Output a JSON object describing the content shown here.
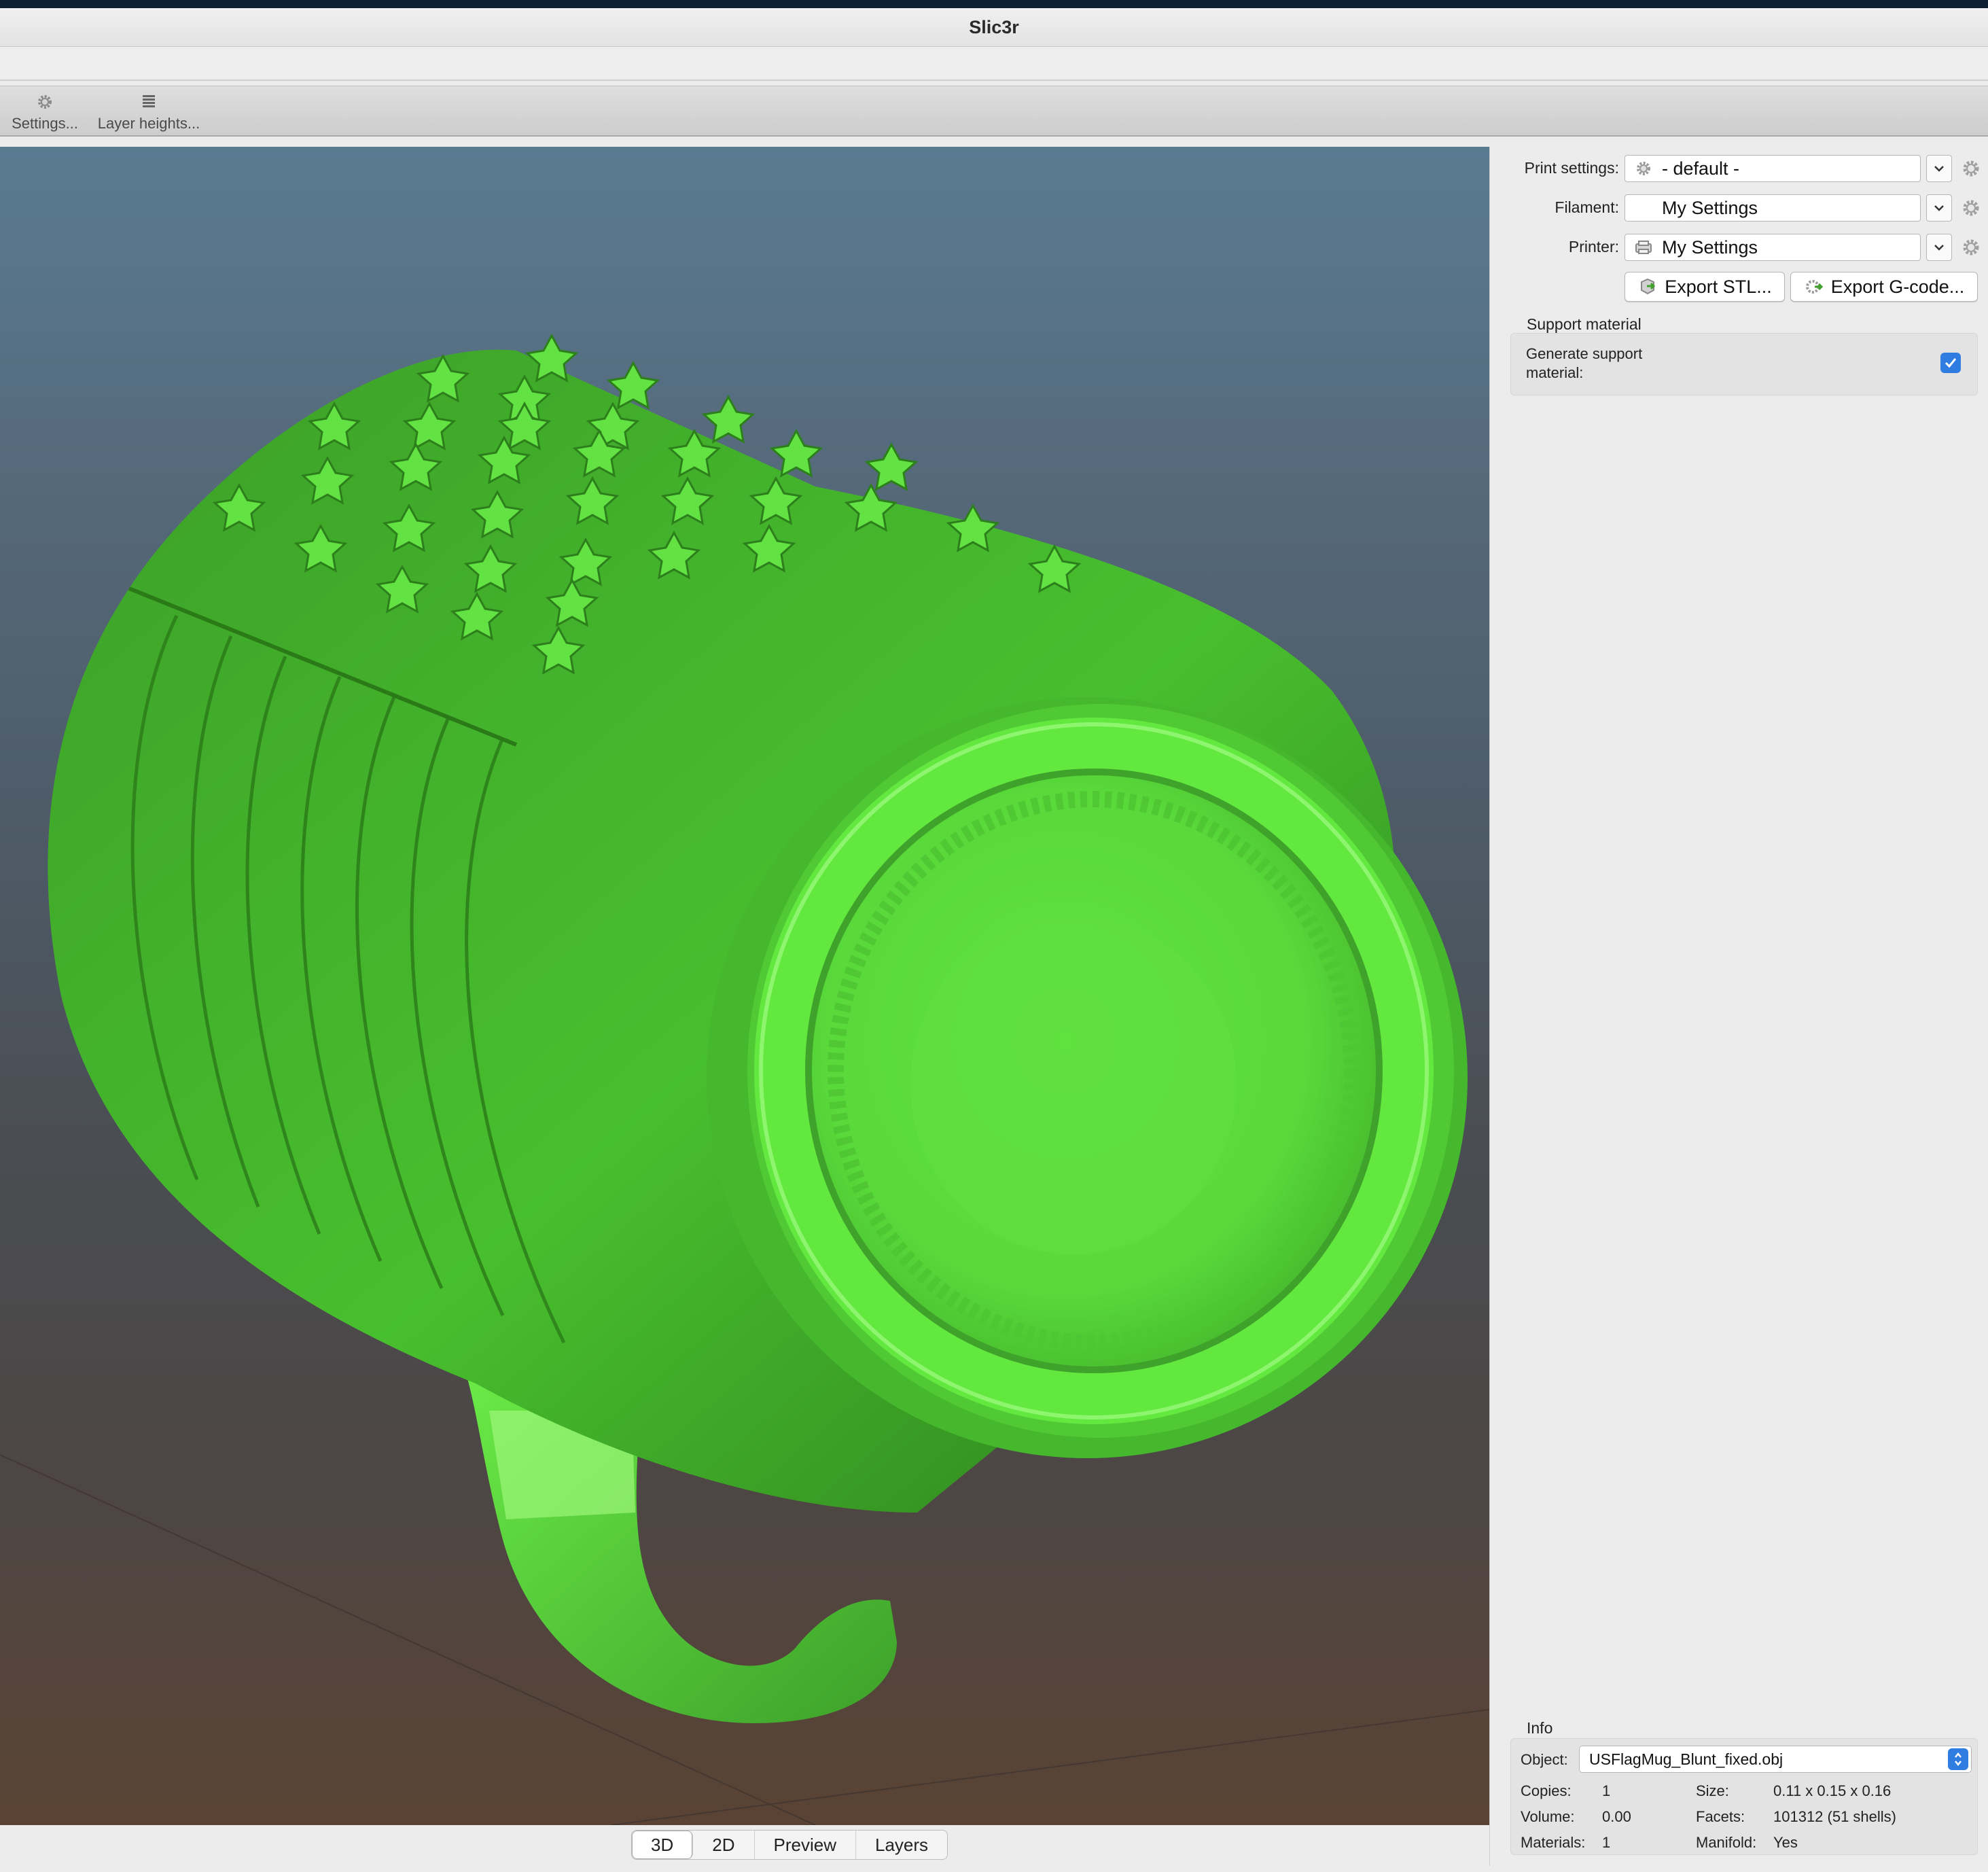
{
  "window": {
    "title": "Slic3r"
  },
  "toolbar": {
    "items": [
      {
        "label": "Settings...",
        "icon": "gear-icon"
      },
      {
        "label": "Layer heights...",
        "icon": "layers-icon"
      }
    ]
  },
  "view_tabs": {
    "items": [
      "3D",
      "2D",
      "Preview",
      "Layers"
    ],
    "active": "3D"
  },
  "presets": {
    "print": {
      "label": "Print settings:",
      "value": "- default -",
      "icon": "gear-icon"
    },
    "filament": {
      "label": "Filament:",
      "value": "My Settings",
      "icon": "none"
    },
    "printer": {
      "label": "Printer:",
      "value": "My Settings",
      "icon": "printer-icon"
    }
  },
  "actions": {
    "export_stl": "Export STL...",
    "export_gcode": "Export G-code..."
  },
  "support": {
    "section_title": "Support material",
    "generate_label": "Generate support material:",
    "generate_checked": true
  },
  "info": {
    "section_title": "Info",
    "object_label": "Object:",
    "object_value": "USFlagMug_Blunt_fixed.obj",
    "copies_label": "Copies:",
    "copies_value": "1",
    "size_label": "Size:",
    "size_value": "0.11 x 0.15 x 0.16",
    "volume_label": "Volume:",
    "volume_value": "0.00",
    "facets_label": "Facets:",
    "facets_value": "101312 (51 shells)",
    "materials_label": "Materials:",
    "materials_value": "1",
    "manifold_label": "Manifold:",
    "manifold_value": "Yes"
  },
  "colors": {
    "model_green": "#5fe040",
    "model_green_dark": "#2f9a1f",
    "checkbox_blue": "#2f7de1",
    "viewport_top": "#597b92",
    "viewport_bottom": "#5a4334"
  }
}
